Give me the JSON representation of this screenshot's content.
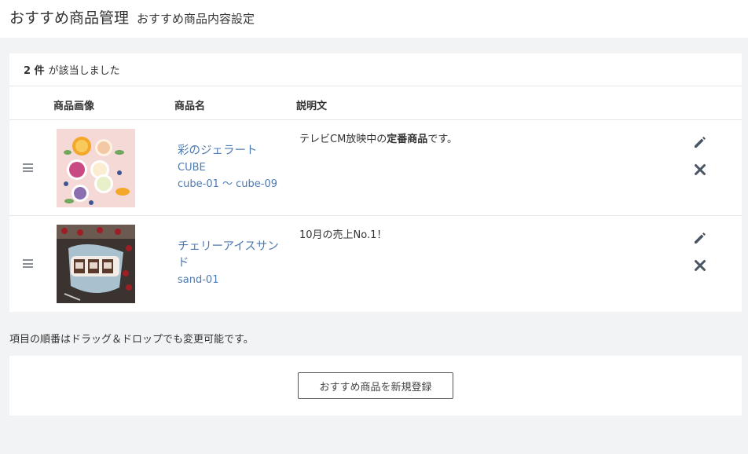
{
  "header": {
    "title": "おすすめ商品管理",
    "subtitle": "おすすめ商品内容設定"
  },
  "list": {
    "count": "2 件",
    "count_suffix": "が該当しました",
    "columns": {
      "image": "商品画像",
      "name": "商品名",
      "description": "説明文"
    },
    "items": [
      {
        "name": "彩のジェラート",
        "code": "CUBE",
        "range": "cube-01 ～ cube-09",
        "description_pre": "テレビCM放映中の",
        "description_bold": "定番商品",
        "description_post": "です。"
      },
      {
        "name": "チェリーアイスサンド",
        "code": "sand-01",
        "description": "10月の売上No.1！"
      }
    ]
  },
  "note": "項目の順番はドラッグ＆ドロップでも変更可能です。",
  "add_button": "おすすめ商品を新規登録",
  "icons": {
    "drag": "drag-handle-icon",
    "edit": "pencil-icon",
    "delete": "close-icon"
  },
  "colors": {
    "link": "#4d7ab1",
    "icon": "#4a5563"
  }
}
